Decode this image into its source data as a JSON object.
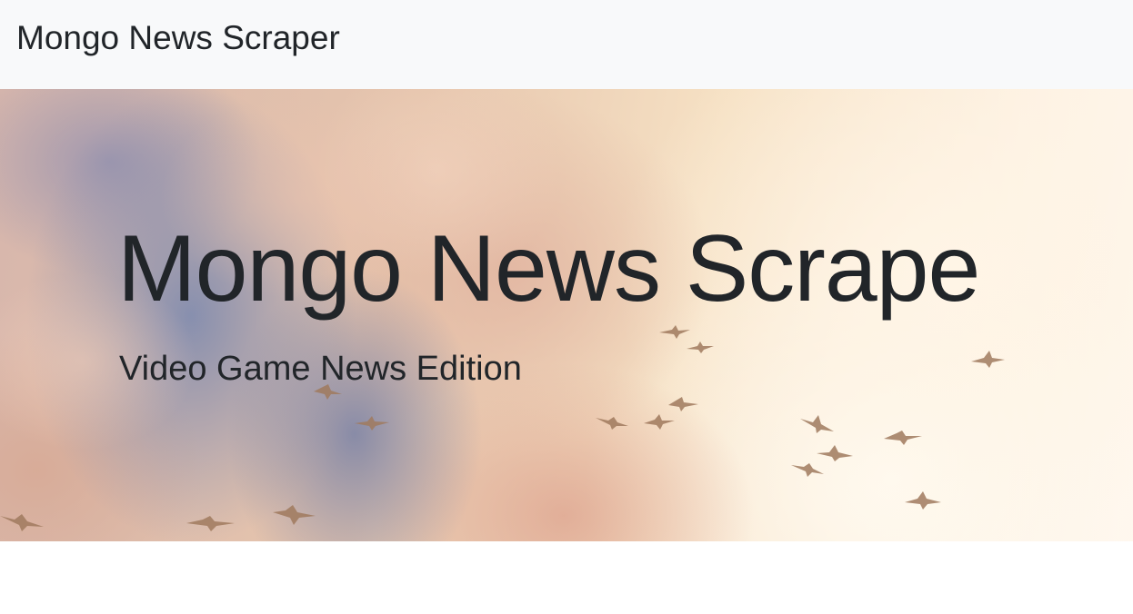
{
  "navbar": {
    "brand": "Mongo News Scraper"
  },
  "hero": {
    "title": "Mongo News Scrape",
    "subtitle": "Video Game News Edition",
    "background_image": "sky-clouds-birds-painting"
  },
  "colors": {
    "navbar_bg": "#f8f9fa",
    "text": "#212529",
    "page_bg": "#ffffff"
  }
}
